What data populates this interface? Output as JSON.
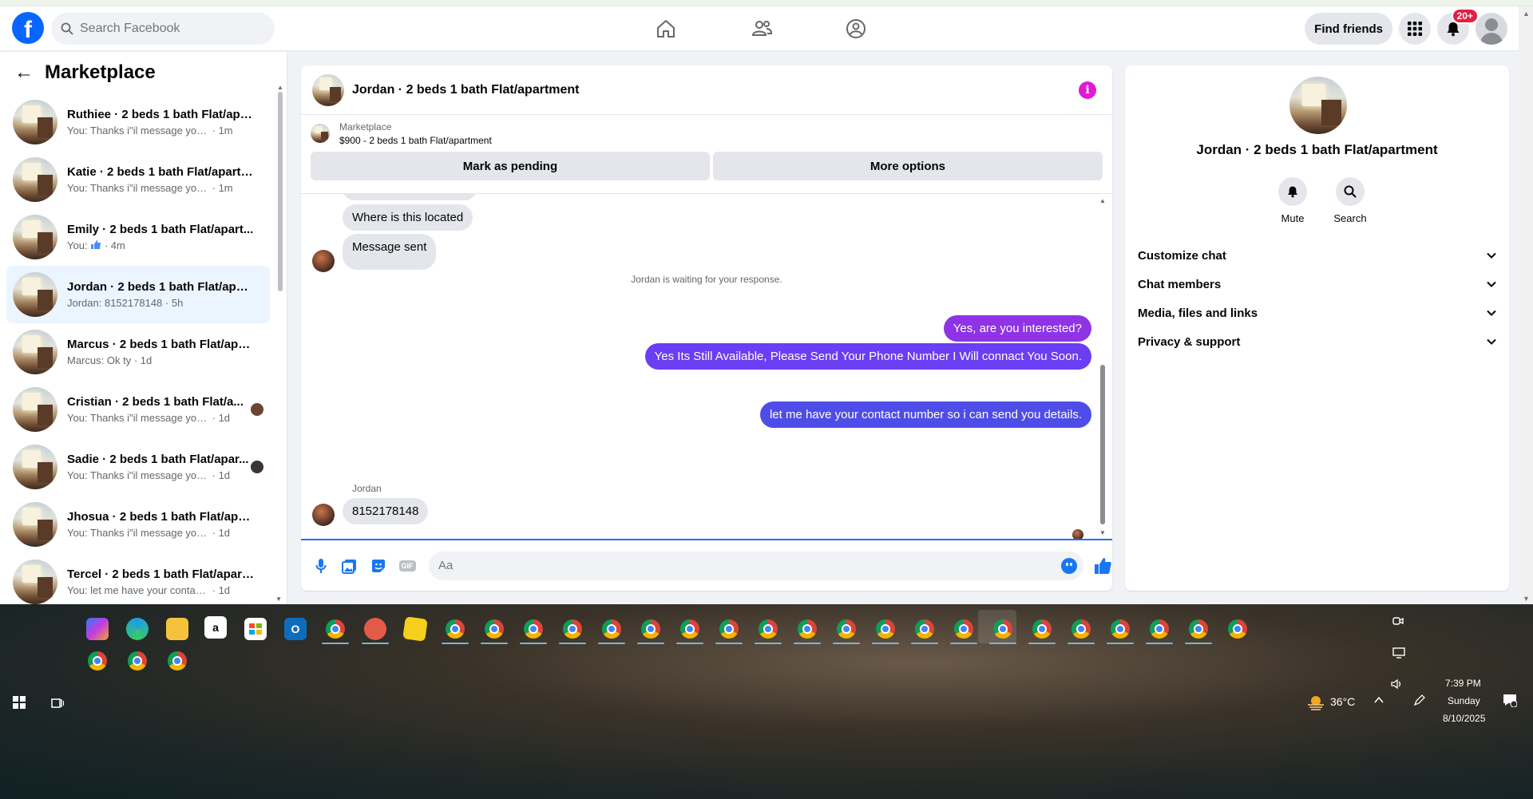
{
  "header": {
    "search_placeholder": "Search Facebook",
    "find_friends_label": "Find friends",
    "notification_badge": "20+"
  },
  "sidebar": {
    "title": "Marketplace",
    "conversations": [
      {
        "name": "Ruthiee · 2 beds 1 bath Flat/apar...",
        "preview": "You: Thanks i\"il message you in a ...",
        "time": "· 1m"
      },
      {
        "name": "Katie · 2 beds 1 bath Flat/apartm...",
        "preview": "You: Thanks i\"il message you in a ...",
        "time": "· 1m"
      },
      {
        "name": "Emily · 2 beds 1 bath Flat/apart...",
        "preview": "You:",
        "time": "· 4m"
      },
      {
        "name": "Jordan · 2 beds 1 bath Flat/apart...",
        "preview": "Jordan: 8152178148",
        "time": "· 5h"
      },
      {
        "name": "Marcus · 2 beds 1 bath Flat/apar...",
        "preview": "Marcus: Ok ty",
        "time": "· 1d"
      },
      {
        "name": "Cristian · 2 beds 1 bath Flat/a...",
        "preview": "You: Thanks i\"il message you in ...",
        "time": "· 1d"
      },
      {
        "name": "Sadie · 2 beds 1 bath Flat/apar...",
        "preview": "You: Thanks i\"il message you in ...",
        "time": "· 1d"
      },
      {
        "name": "Jhosua · 2 beds 1 bath Flat/apart...",
        "preview": "You: Thanks i\"il message you in a ...",
        "time": "· 1d"
      },
      {
        "name": "Tercel · 2 beds 1 bath Flat/apart...",
        "preview": "You: let me have your contact num...",
        "time": "· 1d"
      }
    ]
  },
  "chat": {
    "title": "Jordan · 2 beds 1 bath Flat/apartment",
    "listing_source": "Marketplace",
    "listing_text": "$900 - 2 beds 1 bath Flat/apartment",
    "mark_pending_label": "Mark as pending",
    "more_options_label": "More options",
    "messages": {
      "in_location": "Where is this located",
      "in_sent": "Message sent",
      "waiting_notice": "Jordan is waiting for your response.",
      "out_interested": "Yes, are you interested?",
      "out_available": "Yes Its Still Available, Please Send Your Phone Number I Will connact You Soon.",
      "out_contact": "let me have your contact number so i can send you details.",
      "sender_name": "Jordan",
      "in_phone": "8152178148"
    },
    "composer_placeholder": "Aa"
  },
  "info_panel": {
    "title": "Jordan · 2 beds 1 bath Flat/apartment",
    "mute_label": "Mute",
    "search_label": "Search",
    "sections": [
      "Customize chat",
      "Chat members",
      "Media, files and links",
      "Privacy & support"
    ]
  },
  "taskbar": {
    "weather_temp": "36°C",
    "time": "7:39 PM",
    "day": "Sunday",
    "date": "8/10/2025"
  },
  "colors": {
    "fb_blue": "#0866ff",
    "bubble_purple": "#8f33e6",
    "bubble_violet": "#6a3ef2",
    "bubble_indigo": "#4f4de8",
    "info_magenta": "#e11ad6"
  }
}
